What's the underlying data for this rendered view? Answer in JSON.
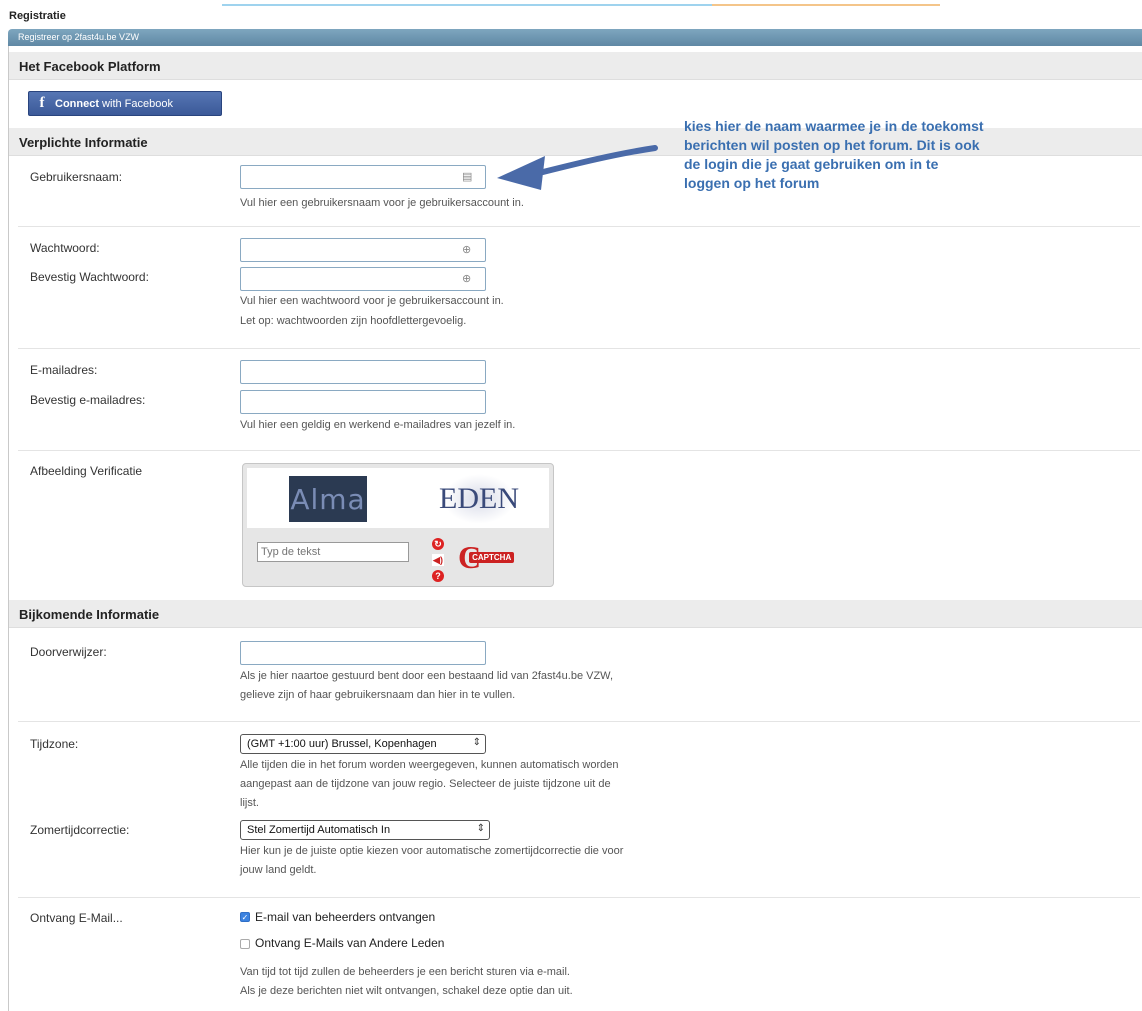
{
  "page": {
    "title": "Registratie",
    "board_header": "Registreer op 2fast4u.be VZW"
  },
  "facebook": {
    "section": "Het Facebook Platform",
    "button_logo": "f",
    "button_bold": "Connect",
    "button_rest": " with Facebook"
  },
  "required": {
    "section": "Verplichte Informatie",
    "username_label": "Gebruikersnaam:",
    "username_value": "",
    "username_help": "Vul hier een gebruikersnaam voor je gebruikersaccount in.",
    "password_label": "Wachtwoord:",
    "password_confirm_label": "Bevestig Wachtwoord:",
    "password_help_1": "Vul hier een wachtwoord voor je gebruikersaccount in.",
    "password_help_2": "Let op: wachtwoorden zijn hoofdlettergevoelig.",
    "email_label": "E-mailadres:",
    "email_confirm_label": "Bevestig e-mailadres:",
    "email_help": "Vul hier een geldig en werkend e-mailadres van jezelf in.",
    "captcha_label": "Afbeelding Verificatie",
    "captcha_word_1": "Alma",
    "captcha_word_2": "EDEN",
    "captcha_placeholder": "Typ de tekst",
    "captcha_brand": "CAPTCHA"
  },
  "annotation": {
    "line_1": "kies hier de naam waarmee je in de toekomst",
    "line_2": "berichten wil posten op het forum. Dit is ook",
    "line_3": "de login die je gaat gebruiken om in te",
    "line_4": "loggen op het forum"
  },
  "additional": {
    "section": "Bijkomende Informatie",
    "referrer_label": "Doorverwijzer:",
    "referrer_help_1": "Als je hier naartoe gestuurd bent door een bestaand lid van 2fast4u.be VZW,",
    "referrer_help_2": "gelieve zijn of haar gebruikersnaam dan hier in te vullen.",
    "timezone_label": "Tijdzone:",
    "timezone_value": "(GMT +1:00 uur) Brussel, Kopenhagen",
    "timezone_help_1": "Alle tijden die in het forum worden weergegeven, kunnen automatisch worden",
    "timezone_help_2": "aangepast aan de tijdzone van jouw regio. Selecteer de juiste tijdzone uit de",
    "timezone_help_3": "lijst.",
    "dst_label": "Zomertijdcorrectie:",
    "dst_value": "Stel Zomertijd Automatisch In",
    "dst_help_1": "Hier kun je de juiste optie kiezen voor automatische zomertijdcorrectie die voor",
    "dst_help_2": "jouw land geldt.",
    "email_opts_label": "Ontvang E-Mail...",
    "opt_admin_label": "E-mail van beheerders ontvangen",
    "opt_admin_checked": true,
    "opt_members_label": "Ontvang E-Mails van Andere Leden",
    "opt_members_checked": false,
    "email_opts_help_1": "Van tijd tot tijd zullen de beheerders je een bericht sturen via e-mail.",
    "email_opts_help_2": "Als je deze berichten niet wilt ontvangen, schakel deze optie dan uit."
  },
  "colors": {
    "header_blue": "#5f88a4",
    "facebook_blue": "#3b5998",
    "annotation_blue": "#3a6fb0",
    "input_border": "#8aa9c2"
  }
}
